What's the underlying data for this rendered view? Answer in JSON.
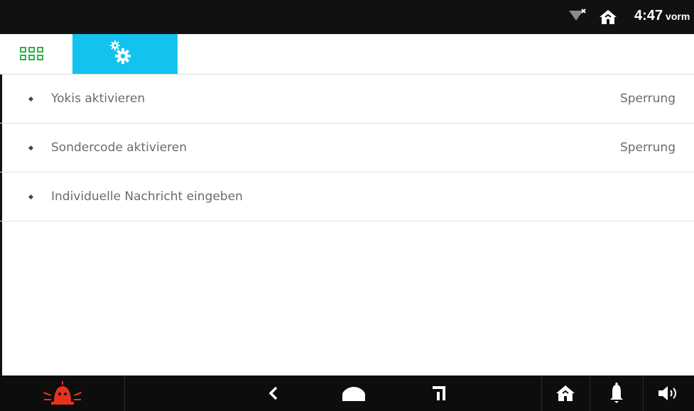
{
  "status_bar": {
    "time": "4:47",
    "ampm": "vorm",
    "icons": [
      "wifi-off-icon",
      "home-icon"
    ]
  },
  "tabs": [
    {
      "name": "apps-grid",
      "icon": "grid-icon",
      "active": false
    },
    {
      "name": "settings",
      "icon": "gears-icon",
      "active": true
    }
  ],
  "settings_list": [
    {
      "label": "Yokis aktivieren",
      "value": "Sperrung"
    },
    {
      "label": "Sondercode aktivieren",
      "value": "Sperrung"
    },
    {
      "label": "Individuelle Nachricht eingeben",
      "value": ""
    }
  ],
  "nav_bar": {
    "buttons": [
      "alarm-icon",
      "back-icon",
      "home-icon",
      "recent-apps-icon",
      "house-icon",
      "bell-icon",
      "volume-icon"
    ]
  },
  "colors": {
    "accent_tab": "#12c3ee",
    "grid_green": "#2db34a",
    "alarm_red": "#e8321f",
    "status_bar": "#111111",
    "text_gray": "#6b6b6b"
  }
}
